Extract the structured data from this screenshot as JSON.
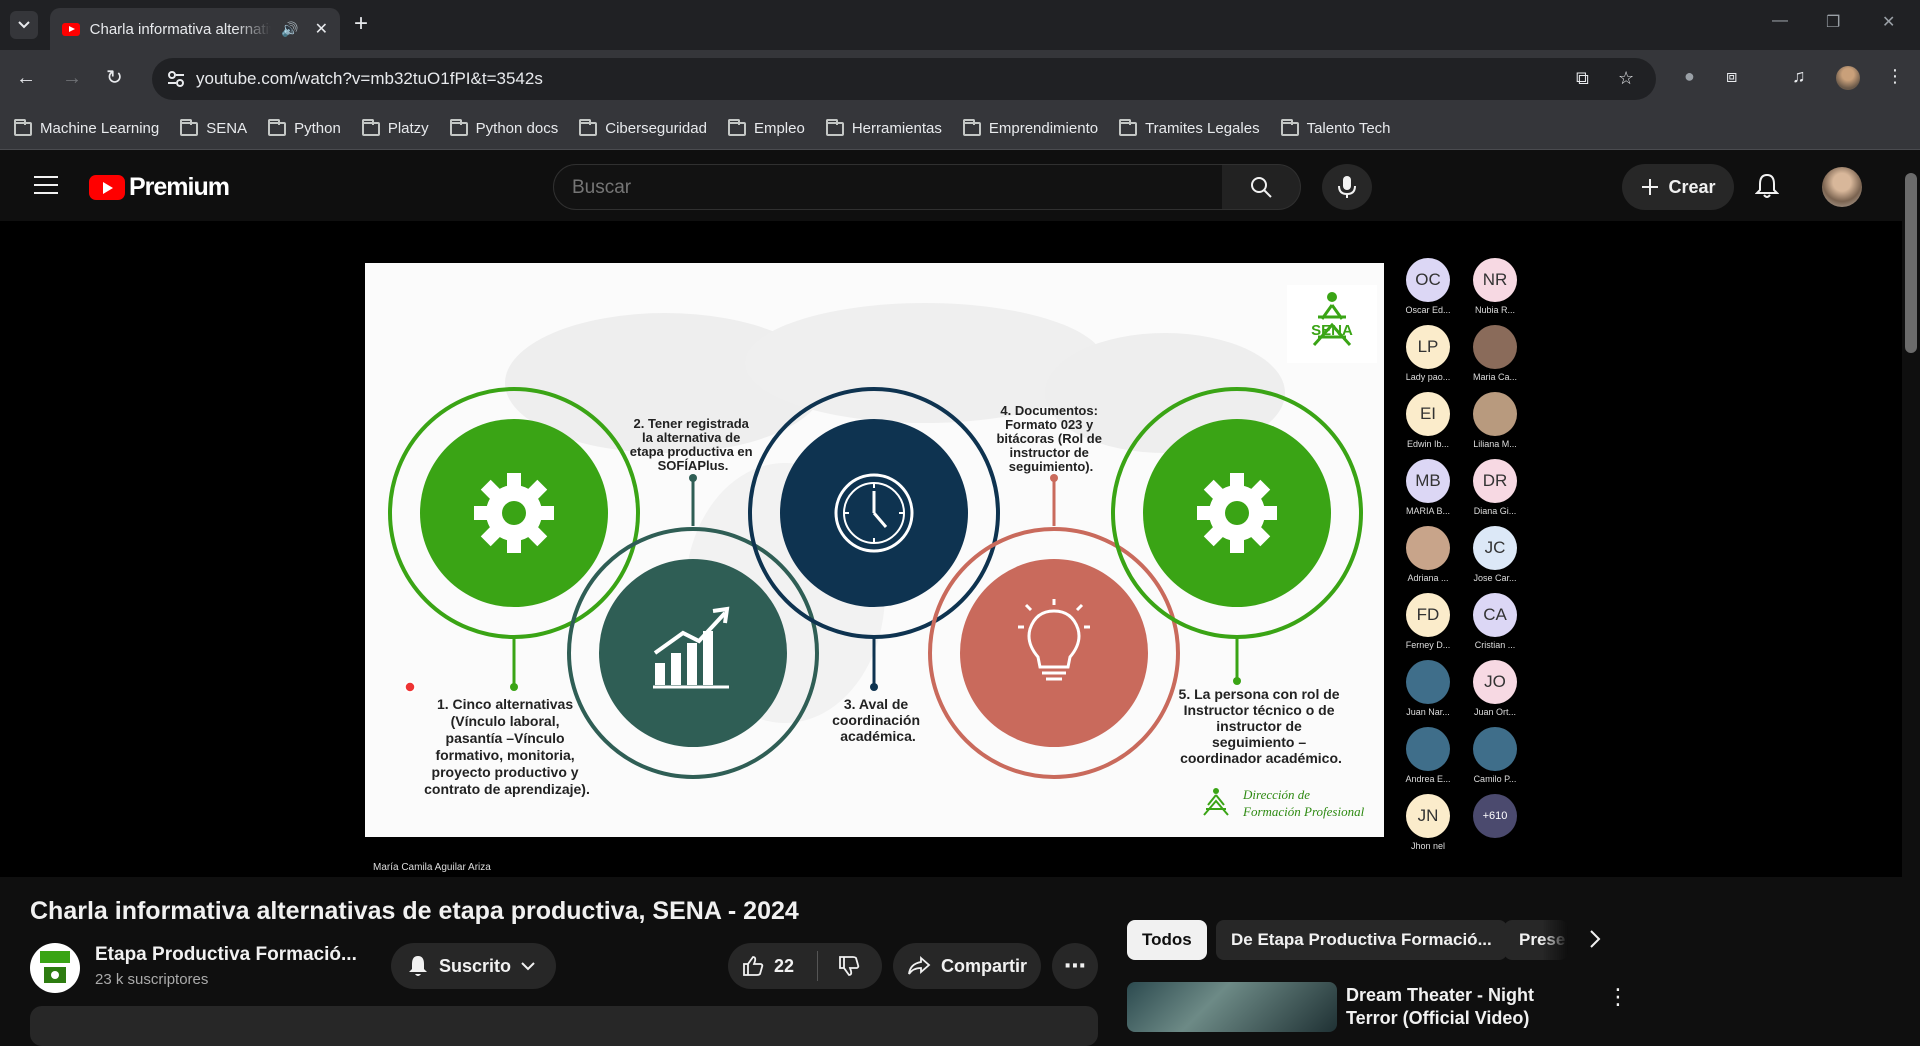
{
  "browser": {
    "tab_title": "Charla informativa alternativas de etapa productiva",
    "url": "youtube.com/watch?v=mb32tuO1fPI&t=3542s",
    "bookmarks": [
      "Machine Learning",
      "SENA",
      "Python",
      "Platzy",
      "Python docs",
      "Ciberseguridad",
      "Empleo",
      "Herramientas",
      "Emprendimiento",
      "Tramites Legales",
      "Talento Tech"
    ]
  },
  "header": {
    "logo_text": "Premium",
    "search_placeholder": "Buscar",
    "create_label": "Crear"
  },
  "slide": {
    "item1": [
      "1. Cinco alternativas",
      "(Vínculo laboral,",
      "pasantía –Vínculo",
      "formativo, monitoria,",
      "proyecto productivo y",
      "contrato de aprendizaje)."
    ],
    "item2": [
      "2. Tener registrada",
      "la alternativa de",
      "etapa productiva en",
      "SOFÍAPlus."
    ],
    "item3": [
      "3. Aval de",
      "coordinación",
      "académica."
    ],
    "item4": [
      "4. Documentos:",
      "Formato 023 y",
      "bitácoras (Rol de",
      "instructor de",
      "seguimiento)."
    ],
    "item5": [
      "5. La persona con rol de",
      "Instructor técnico o de",
      "instructor de",
      "seguimiento –",
      "coordinador académico."
    ],
    "logo": "SENA",
    "footer": [
      "Dirección de",
      "Formación Profesional"
    ]
  },
  "participants": [
    {
      "initials": "OC",
      "name": "Oscar Ed...",
      "bg": "#dcd7f5"
    },
    {
      "initials": "NR",
      "name": "Nubia R...",
      "bg": "#f7d9e3"
    },
    {
      "initials": "LP",
      "name": "Lady pao...",
      "bg": "#fbeccb"
    },
    {
      "initials": "",
      "name": "Maria Ca...",
      "bg": "#8a6b5a"
    },
    {
      "initials": "EI",
      "name": "Edwin Ib...",
      "bg": "#fbeccb"
    },
    {
      "initials": "",
      "name": "Liliana M...",
      "bg": "#b89a7e"
    },
    {
      "initials": "MB",
      "name": "MARIA B...",
      "bg": "#dcd7f5"
    },
    {
      "initials": "DR",
      "name": "Diana Gi...",
      "bg": "#f7d9e3"
    },
    {
      "initials": "",
      "name": "Adriana ...",
      "bg": "#c8a48a"
    },
    {
      "initials": "JC",
      "name": "Jose Car...",
      "bg": "#dce8f7"
    },
    {
      "initials": "FD",
      "name": "Ferney D...",
      "bg": "#fbeccb"
    },
    {
      "initials": "CA",
      "name": "Cristian ...",
      "bg": "#dcd7f5"
    },
    {
      "initials": "",
      "name": "Juan Nar...",
      "bg": "#3f6e8a"
    },
    {
      "initials": "JO",
      "name": "Juan Ort...",
      "bg": "#f7d9e3"
    },
    {
      "initials": "",
      "name": "Andrea E...",
      "bg": "#3f6e8a"
    },
    {
      "initials": "",
      "name": "Camilo P...",
      "bg": "#3f6e8a"
    },
    {
      "initials": "JN",
      "name": "Jhon nel",
      "bg": "#fbeccb"
    },
    {
      "initials": "+610",
      "name": "",
      "bg": "#4b4a6e"
    }
  ],
  "presenter": "María Camila Aguilar Ariza",
  "video": {
    "title": "Charla informativa alternativas de etapa productiva, SENA - 2024",
    "channel": "Etapa Productiva Formació...",
    "subscribers": "23 k suscriptores",
    "subscribed_label": "Suscrito",
    "likes": "22",
    "share_label": "Compartir"
  },
  "chips": [
    "Todos",
    "De Etapa Productiva Formació...",
    "Prese"
  ],
  "recommendation": {
    "title": "Dream Theater - Night Terror (Official Video)"
  },
  "colors": {
    "green": "#3aa415",
    "navy": "#0e3350",
    "teal": "#2f5e55",
    "salmon": "#c96a5c"
  }
}
